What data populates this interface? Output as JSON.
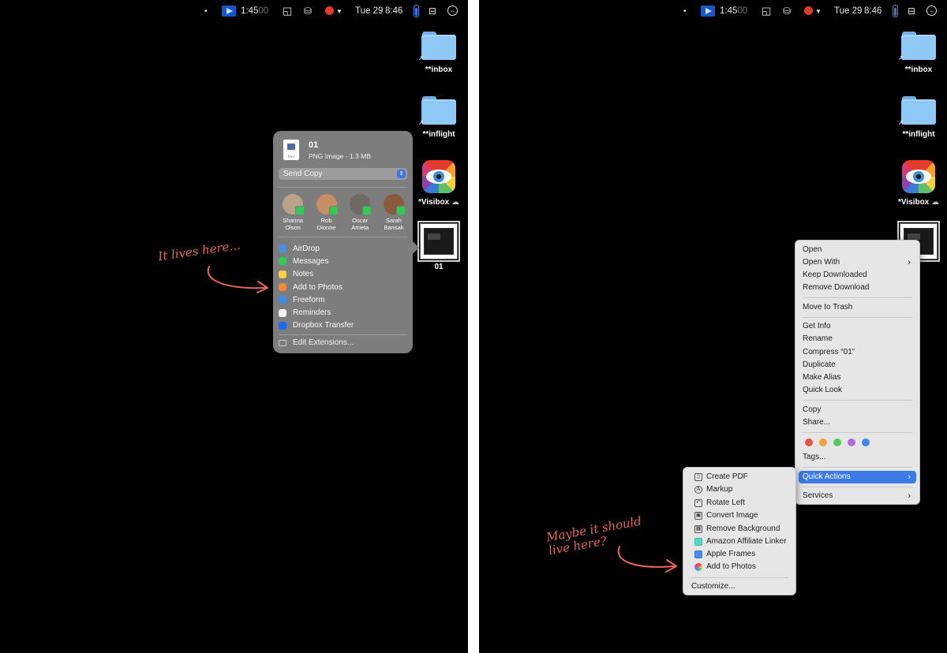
{
  "menubar": {
    "time_elapsed": "1:45",
    "time_sub": "00",
    "date": "Tue 29",
    "clock": "8:46"
  },
  "desktop": {
    "inbox_label": "**inbox",
    "inflight_label": "**inflight",
    "visibox_label": "*Visibox",
    "file_label": "01"
  },
  "share_sheet": {
    "file_name": "01",
    "file_meta": "PNG Image · 1.3 MB",
    "send_option": "Send Copy",
    "people": [
      {
        "first": "Shanna",
        "last": "Olson",
        "color": "#b9a48a"
      },
      {
        "first": "Rob",
        "last": "Dionne",
        "color": "#c88e63"
      },
      {
        "first": "Oscar",
        "last": "Arrieta",
        "color": "#6f6a63"
      },
      {
        "first": "Sarah",
        "last": "Bansak",
        "color": "#8a5a3c"
      }
    ],
    "items": [
      {
        "label": "AirDrop",
        "icon": "airdrop-icon",
        "color": "#4a90e2"
      },
      {
        "label": "Messages",
        "icon": "messages-icon",
        "color": "#34c759"
      },
      {
        "label": "Notes",
        "icon": "notes-icon",
        "color": "#f5d14a"
      },
      {
        "label": "Add to Photos",
        "icon": "photos-icon",
        "color": "#f08a3c"
      },
      {
        "label": "Freeform",
        "icon": "freeform-icon",
        "color": "#3f8ee8"
      },
      {
        "label": "Reminders",
        "icon": "reminders-icon",
        "color": "#f2f2f2"
      },
      {
        "label": "Dropbox Transfer",
        "icon": "dropbox-icon",
        "color": "#1e63ff"
      }
    ],
    "edit_extensions": "Edit Extensions..."
  },
  "annotations": {
    "left": "It lives here...",
    "right_line1": "Maybe it should",
    "right_line2": "live here?"
  },
  "context_menu": {
    "open": "Open",
    "open_with": "Open With",
    "keep_downloaded": "Keep Downloaded",
    "remove_download": "Remove Download",
    "move_to_trash": "Move to Trash",
    "get_info": "Get Info",
    "rename": "Rename",
    "compress": "Compress “01”",
    "duplicate": "Duplicate",
    "make_alias": "Make Alias",
    "quick_look": "Quick Look",
    "copy": "Copy",
    "share": "Share...",
    "tags": "Tags...",
    "tag_colors": [
      "#e8544a",
      "#f2a23c",
      "#56c95a",
      "#b66ad9",
      "#3f86ef"
    ],
    "quick_actions": "Quick Actions",
    "services": "Services"
  },
  "quick_actions_menu": {
    "items": [
      {
        "label": "Create PDF",
        "icon": "document-icon"
      },
      {
        "label": "Markup",
        "icon": "markup-icon"
      },
      {
        "label": "Rotate Left",
        "icon": "rotate-left-icon"
      },
      {
        "label": "Convert Image",
        "icon": "image-icon"
      },
      {
        "label": "Remove Background",
        "icon": "remove-background-icon"
      },
      {
        "label": "Amazon Affiliate Linker",
        "icon": "linker-icon"
      },
      {
        "label": "Apple Frames",
        "icon": "frames-icon"
      },
      {
        "label": "Add to Photos",
        "icon": "photos-icon"
      }
    ],
    "customize": "Customize..."
  }
}
